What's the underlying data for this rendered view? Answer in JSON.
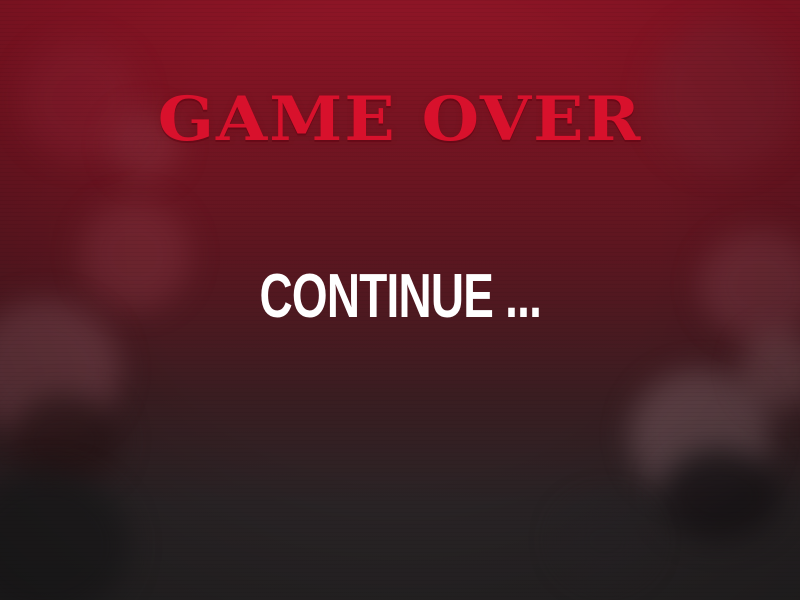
{
  "game_over": {
    "title": "GAME OVER",
    "title_color": "#d8112c",
    "continue_label": "CONTINUE ...",
    "continue_color": "#ffffff"
  },
  "background": {
    "top_color": "#8e1526",
    "bottom_color": "#262324",
    "style": "blurred-scene"
  }
}
